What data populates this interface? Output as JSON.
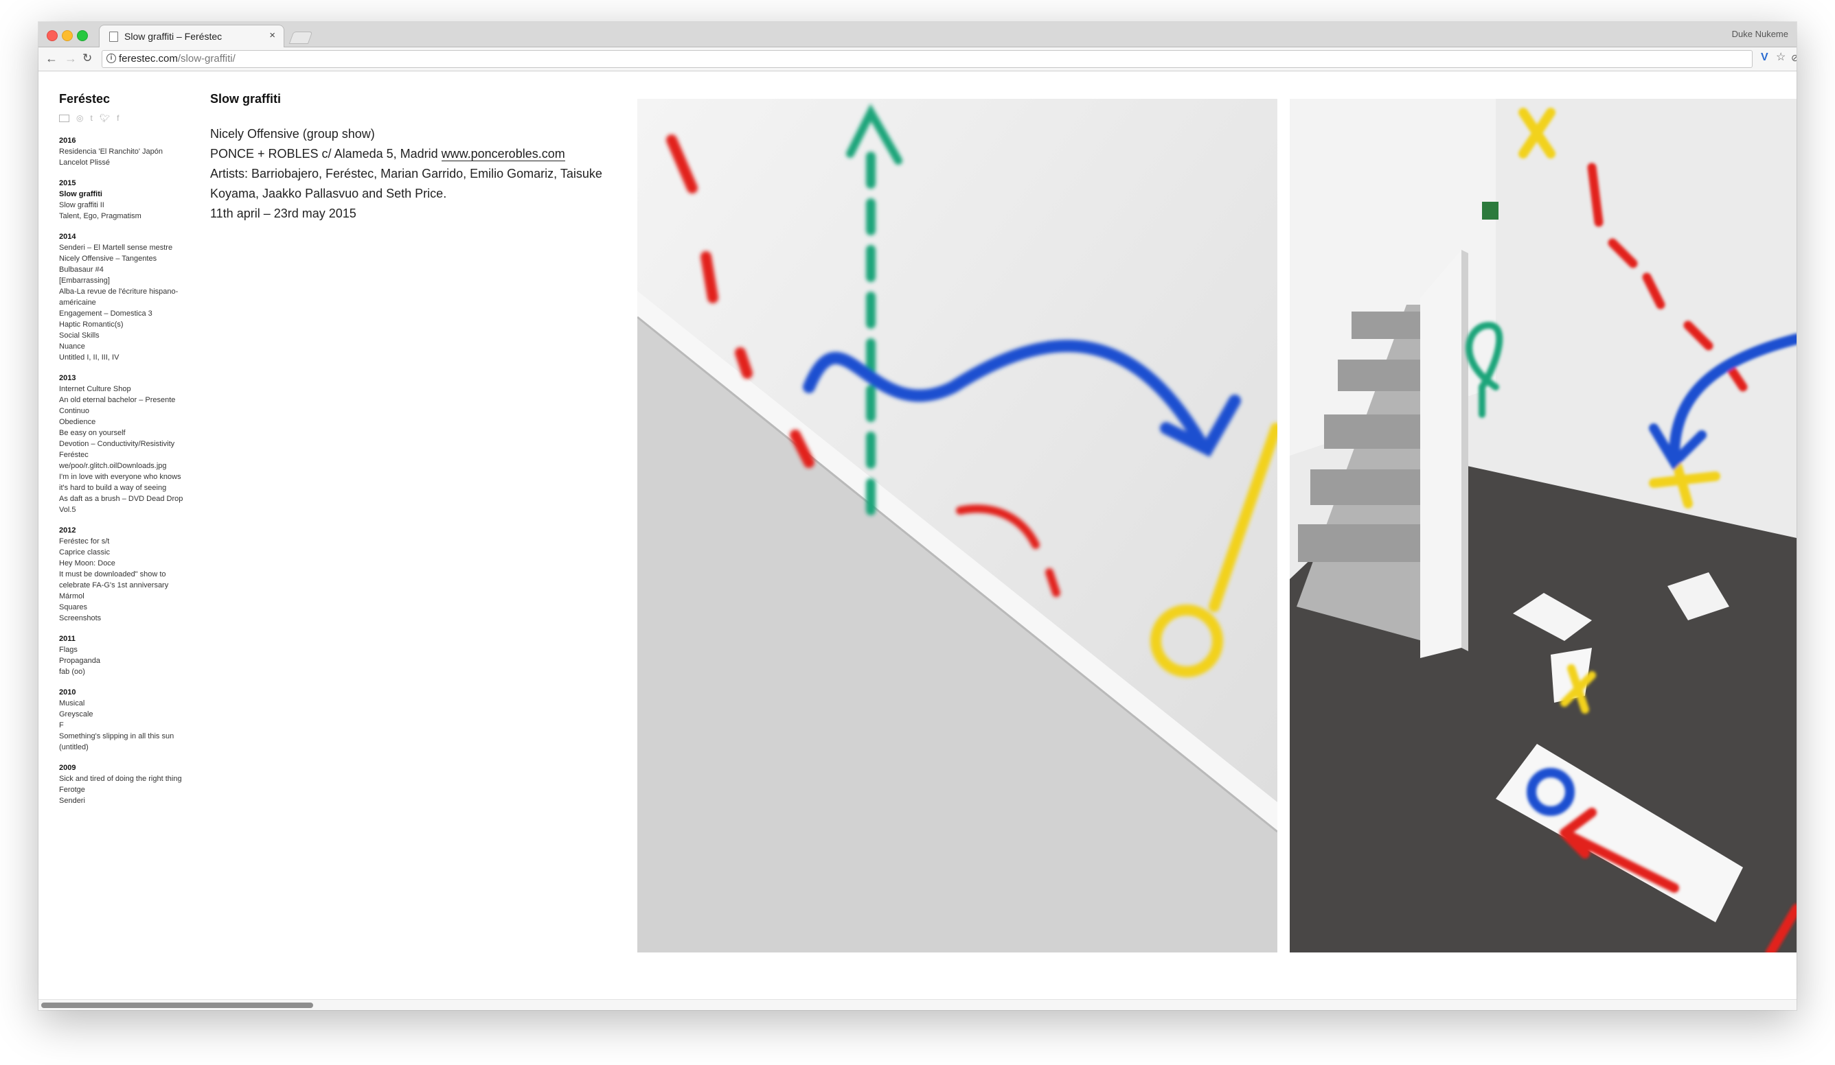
{
  "browser": {
    "tab_title": "Slow graffiti – Feréstec",
    "tab_close": "×",
    "profile_name": "Duke Nukeme",
    "url_host": "ferestec.com",
    "url_path": "/slow-graffiti/",
    "icons": [
      "back-arrow-icon",
      "forward-arrow-icon",
      "reload-icon",
      "info-icon",
      "extension-v-icon",
      "star-icon",
      "extension-shield-icon",
      "menu-dots-icon"
    ]
  },
  "sidebar": {
    "site_title": "Feréstec",
    "social_icons": [
      "email-icon",
      "instagram-icon",
      "tumblr-icon",
      "twitter-icon",
      "facebook-icon"
    ],
    "years": [
      {
        "year": "2016",
        "entries": [
          "Residencia 'El Ranchito' Japón",
          "Lancelot Plissé"
        ]
      },
      {
        "year": "2015",
        "entries": [
          "Slow graffiti",
          "Slow graffiti II",
          "Talent, Ego, Pragmatism"
        ]
      },
      {
        "year": "2014",
        "entries": [
          "Senderi – El Martell sense mestre",
          "Nicely Offensive – Tangentes",
          "Bulbasaur #4",
          "[Embarrassing]",
          "Alba-La revue de l'écriture hispano-américaine",
          "Engagement – Domestica 3",
          "Haptic Romantic(s)",
          "Social Skills",
          "Nuance",
          "Untitled I, II, III, IV"
        ]
      },
      {
        "year": "2013",
        "entries": [
          "Internet Culture Shop",
          "An old eternal bachelor – Presente Continuo",
          "Obedience",
          "Be easy on yourself",
          "Devotion – Conductivity/Resistivity",
          "Feréstec",
          "we/poo/r.glitch.oilDownloads.jpg",
          "I'm in love with everyone who knows it's hard to build a way of seeing",
          "As daft as a brush – DVD Dead Drop Vol.5"
        ]
      },
      {
        "year": "2012",
        "entries": [
          "Feréstec for s/t",
          "Caprice classic",
          "Hey Moon: Doce",
          "It must be downloaded\" show to celebrate FA-G's 1st anniversary",
          "Mármol",
          "Squares",
          "Screenshots"
        ]
      },
      {
        "year": "2011",
        "entries": [
          "Flags",
          "Propaganda",
          "fab (oo)"
        ]
      },
      {
        "year": "2010",
        "entries": [
          "Musical",
          "Greyscale",
          "F",
          "Something's slipping in all this sun",
          "(untitled)"
        ]
      },
      {
        "year": "2009",
        "entries": [
          "Sick and tired of doing the right thing",
          "Ferotge",
          "Senderi"
        ]
      }
    ]
  },
  "content": {
    "title": "Slow graffiti",
    "line1": "Nicely Offensive (group show)",
    "line2_prefix": "PONCE + ROBLES c/ Alameda 5, Madrid ",
    "link": "www.poncerobles.com",
    "line3": "Artists: Barriobajero, Feréstec, Marian Garrido, Emilio Gomariz, Taisuke Koyama, Jaakko Pallasvuo and Seth Price.",
    "line4": "11th april – 23rd may 2015",
    "photos": [
      "graffiti-stairwall-photo",
      "graffiti-installation-overview-photo"
    ],
    "colors": {
      "red": "#e2231a",
      "blue": "#1a4fd0",
      "green": "#1aa57a",
      "yellow": "#f2d21b"
    }
  }
}
